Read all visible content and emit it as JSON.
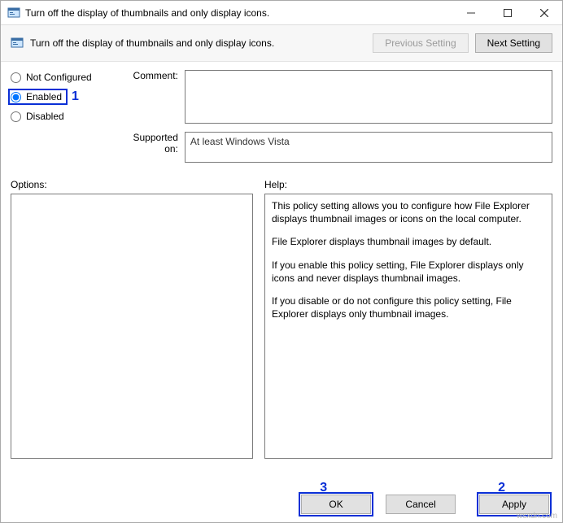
{
  "window": {
    "title": "Turn off the display of thumbnails and only display icons."
  },
  "toolbar": {
    "label": "Turn off the display of thumbnails and only display icons.",
    "prev": "Previous Setting",
    "next": "Next Setting"
  },
  "radios": {
    "not_configured": "Not Configured",
    "enabled": "Enabled",
    "disabled": "Disabled"
  },
  "labels": {
    "comment": "Comment:",
    "supported": "Supported on:",
    "options": "Options:",
    "help": "Help:"
  },
  "fields": {
    "comment": "",
    "supported": "At least Windows Vista",
    "options": ""
  },
  "help": {
    "p1": "This policy setting allows you to configure how File Explorer displays thumbnail images or icons on the local computer.",
    "p2": "File Explorer displays thumbnail images by default.",
    "p3": "If you enable this policy setting, File Explorer displays only icons and never displays thumbnail images.",
    "p4": "If you disable or do not configure this policy setting, File Explorer displays only thumbnail images."
  },
  "buttons": {
    "ok": "OK",
    "cancel": "Cancel",
    "apply": "Apply"
  },
  "annotations": {
    "one": "1",
    "two": "2",
    "three": "3"
  },
  "watermark": "wsxdn.com"
}
